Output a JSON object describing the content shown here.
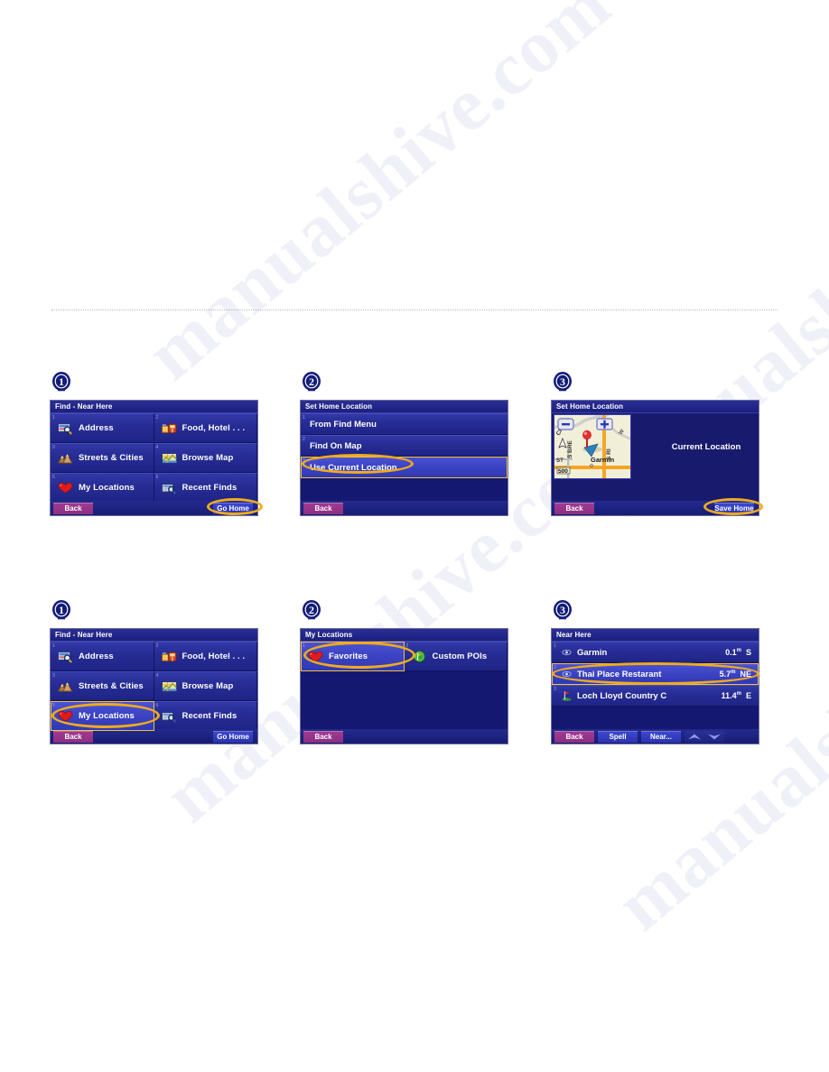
{
  "page": {
    "background": "#ffffff",
    "divider": "dotted",
    "watermark_text": "manualshive.com"
  },
  "colors": {
    "device_bg": "#181a6e",
    "title_bar": "#2b2f96",
    "tile": "#262c93",
    "tile_selected": "#3b43c3",
    "highlight_ring": "#f0ab1d",
    "back_button": "#8c2f80",
    "blue_button": "#2a33ae",
    "map_bg": "#f2efd8",
    "road_major": "#f5a623",
    "badge_blue": "#1c2a8f"
  },
  "rows": [
    {
      "row_id": "row-1",
      "panels": [
        {
          "step": "1",
          "screen_title": "Find - Near Here",
          "layout": "tile-grid",
          "tiles": [
            {
              "num": "1",
              "label": "Address",
              "icon": "address-icon",
              "selected": false
            },
            {
              "num": "2",
              "label": "Food, Hotel . . .",
              "icon": "food-hotel-icon",
              "selected": false
            },
            {
              "num": "3",
              "label": "Streets & Cities",
              "icon": "streets-cities-icon",
              "selected": false
            },
            {
              "num": "4",
              "label": "Browse Map",
              "icon": "browse-map-icon",
              "selected": false
            },
            {
              "num": "5",
              "label": "My Locations",
              "icon": "heart-icon",
              "selected": false
            },
            {
              "num": "6",
              "label": "Recent Finds",
              "icon": "recent-finds-icon",
              "selected": false
            }
          ],
          "toolbar": {
            "back_label": "Back",
            "right_label": "Go Home",
            "right_highlighted": true
          },
          "highlight_target": "go-home-button"
        },
        {
          "step": "2",
          "screen_title": "Set Home Location",
          "layout": "row-list",
          "rows": [
            {
              "num": "1",
              "label": "From Find Menu",
              "selected": false
            },
            {
              "num": "2",
              "label": "Find On Map",
              "selected": false
            },
            {
              "num": "3",
              "label": "Use Current Location",
              "selected": true
            }
          ],
          "toolbar": {
            "back_label": "Back",
            "right_label": "",
            "right_highlighted": false
          },
          "highlight_target": "use-current-location-row"
        },
        {
          "step": "3",
          "screen_title": "Set Home Location",
          "layout": "map",
          "map": {
            "zoom_out_label": "−",
            "zoom_in_label": "+",
            "pin_label": "Garmin",
            "street_labels": [
              "CR",
              "S BRE",
              "ST",
              "500",
              "S RI",
              "W"
            ]
          },
          "side_label": "Current Location",
          "toolbar": {
            "back_label": "Back",
            "right_label": "Save Home",
            "right_highlighted": true
          },
          "highlight_target": "save-home-button"
        }
      ]
    },
    {
      "row_id": "row-2",
      "panels": [
        {
          "step": "1",
          "screen_title": "Find - Near Here",
          "layout": "tile-grid",
          "tiles": [
            {
              "num": "1",
              "label": "Address",
              "icon": "address-icon",
              "selected": false
            },
            {
              "num": "2",
              "label": "Food, Hotel . . .",
              "icon": "food-hotel-icon",
              "selected": false
            },
            {
              "num": "3",
              "label": "Streets & Cities",
              "icon": "streets-cities-icon",
              "selected": false
            },
            {
              "num": "4",
              "label": "Browse Map",
              "icon": "browse-map-icon",
              "selected": false
            },
            {
              "num": "5",
              "label": "My Locations",
              "icon": "heart-icon",
              "selected": true
            },
            {
              "num": "6",
              "label": "Recent Finds",
              "icon": "recent-finds-icon",
              "selected": false
            }
          ],
          "toolbar": {
            "back_label": "Back",
            "right_label": "Go Home",
            "right_highlighted": false
          },
          "highlight_target": "my-locations-tile"
        },
        {
          "step": "2",
          "screen_title": "My Locations",
          "layout": "tile-grid",
          "tiles": [
            {
              "num": "1",
              "label": "Favorites",
              "icon": "heart-icon",
              "selected": true
            },
            {
              "num": "2",
              "label": "Custom POIs",
              "icon": "custom-poi-icon",
              "selected": false
            }
          ],
          "toolbar": {
            "back_label": "Back",
            "right_label": "",
            "right_highlighted": false
          },
          "highlight_target": "favorites-tile"
        },
        {
          "step": "3",
          "screen_title": "Near Here",
          "layout": "result-list",
          "results": [
            {
              "num": "1",
              "label": "Garmin",
              "distance": "0.1",
              "unit": "m",
              "bearing": "S",
              "icon": "poi-dot-icon",
              "selected": false
            },
            {
              "num": "2",
              "label": "Thai Place Restarant",
              "distance": "5.7",
              "unit": "m",
              "bearing": "NE",
              "icon": "poi-dot-icon",
              "selected": true
            },
            {
              "num": "3",
              "label": "Loch Lloyd Country C",
              "distance": "11.4",
              "unit": "m",
              "bearing": "E",
              "icon": "golf-flag-icon",
              "selected": false
            }
          ],
          "toolbar": {
            "back_label": "Back",
            "spell_label": "Spell",
            "near_label": "Near...",
            "scroll_up": "scroll-up-arrow",
            "scroll_down": "scroll-down-arrow"
          },
          "highlight_target": "thai-place-row"
        }
      ]
    }
  ]
}
